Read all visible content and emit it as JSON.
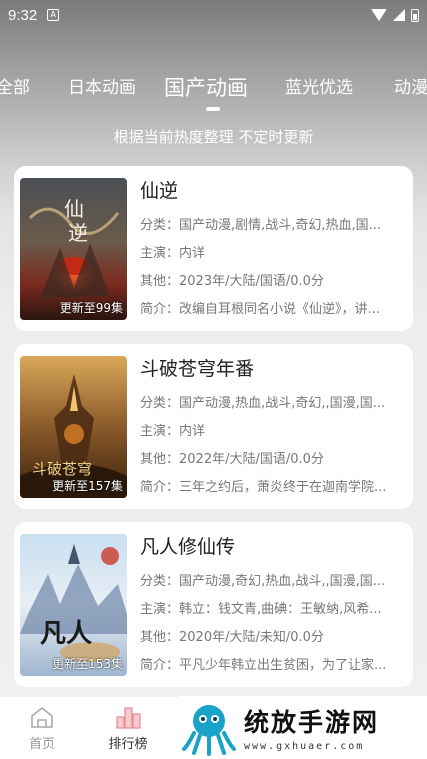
{
  "status_bar": {
    "time": "9:32",
    "notification_icon": "A"
  },
  "tabs": [
    {
      "label": "全部",
      "active": false
    },
    {
      "label": "日本动画",
      "active": false
    },
    {
      "label": "国产动画",
      "active": true
    },
    {
      "label": "蓝光优选",
      "active": false
    },
    {
      "label": "动漫",
      "active": false
    }
  ],
  "subtitle": "根据当前热度整理 不定时更新",
  "cards": [
    {
      "title": "仙逆",
      "episode_badge": "更新至99集",
      "category": "分类：国产动漫,剧情,战斗,奇幻,热血,国...",
      "cast": "主演：内详",
      "other": "其他：2023年/大陆/国语/0.0分",
      "intro": "简介：改编自耳根同名小说《仙逆》，讲..."
    },
    {
      "title": "斗破苍穹年番",
      "episode_badge": "更新至157集",
      "category": "分类：国产动漫,热血,战斗,奇幻,,国漫,国...",
      "cast": "主演：内详",
      "other": "其他：2022年/大陆/国语/0.0分",
      "intro": "简介：三年之约后，萧炎终于在迦南学院..."
    },
    {
      "title": "凡人修仙传",
      "episode_badge": "更新至153集",
      "category": "分类：国产动漫,奇幻,热血,战斗,,国漫,国...",
      "cast": "主演：韩立：钱文青,曲碘：王敏纳,风希...",
      "other": "其他：2020年/大陆/未知/0.0分",
      "intro": "简介：平凡少年韩立出生贫困，为了让家..."
    }
  ],
  "bottom_nav": [
    {
      "label": "首页",
      "icon": "home-icon",
      "active": false
    },
    {
      "label": "排行榜",
      "icon": "ranking-icon",
      "active": true
    }
  ],
  "watermark": {
    "title": "统放手游网",
    "url": "www.gxhuaer.com"
  },
  "colors": {
    "tab_text": "#ffffff",
    "card_bg": "#ffffff",
    "meta_text": "#777777",
    "nav_inactive": "#999999",
    "watermark_accent": "#1aa3c8"
  }
}
